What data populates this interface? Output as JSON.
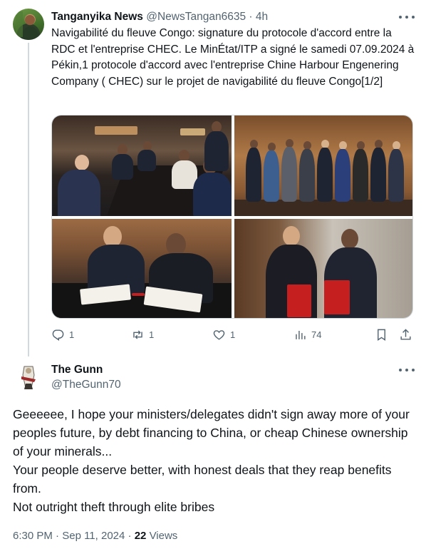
{
  "tweet1": {
    "author_name": "Tanganyika News",
    "handle": "@NewsTangan6635",
    "separator": "·",
    "time": "4h",
    "text": "Navigabilité du fleuve Congo: signature du protocole d'accord entre la RDC et l'entreprise CHEC. Le MinÉtat/ITP a signé le samedi 07.09.2024 à Pékin,1 protocole d'accord avec l'entreprise Chine Harbour Engenering Company ( CHEC) sur le projet de navigabilité du fleuve Congo[1/2]",
    "media_count": 4,
    "actions": {
      "replies": "1",
      "reposts": "1",
      "likes": "1",
      "views": "74"
    }
  },
  "tweet2": {
    "author_name": "The Gunn",
    "handle": "@TheGunn70",
    "paragraphs": [
      "Geeeeee, I hope your ministers/delegates didn't sign away more of your peoples future, by debt financing to China, or cheap Chinese ownership of your minerals...",
      "Your people deserve better, with honest deals that they reap benefits from.",
      "Not outright theft through elite bribes"
    ],
    "time": "6:30 PM",
    "date": "Sep 11, 2024",
    "sep1": "·",
    "sep2": "·",
    "views_count": "22",
    "views_label": "Views"
  },
  "icons": {
    "reply": "reply-icon",
    "repost": "repost-icon",
    "like": "heart-icon",
    "views": "analytics-icon",
    "bookmark": "bookmark-icon",
    "share": "share-icon",
    "more": "more-icon"
  },
  "colors": {
    "text": "#0f1419",
    "secondary": "#536471",
    "thread_line": "#cfd9de"
  }
}
